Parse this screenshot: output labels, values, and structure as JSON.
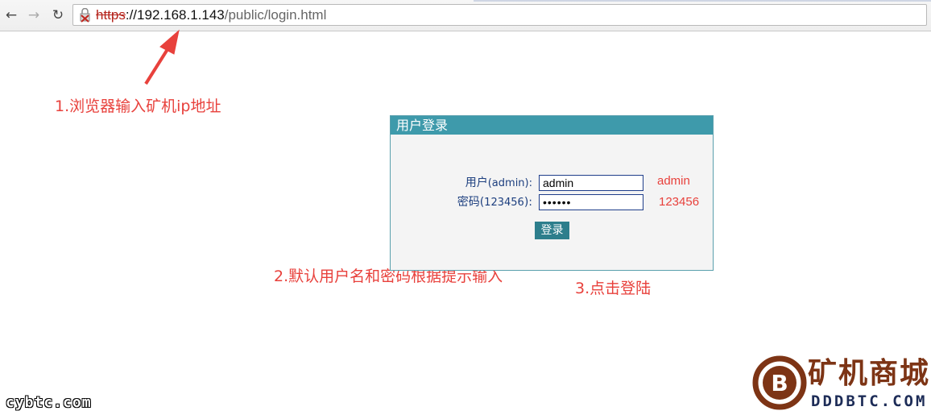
{
  "browser": {
    "url_scheme": "https",
    "url_host": "://192.168.1.143",
    "url_path": "/public/login.html",
    "icons": [
      "back-arrow-icon",
      "forward-arrow-icon",
      "reload-icon",
      "broken-lock-icon"
    ]
  },
  "annotations": {
    "step1": "1.浏览器输入矿机ip地址",
    "step2": "2.默认用户名和密码根据提示输入",
    "step3": "3.点击登陆",
    "hint_user": "admin",
    "hint_pass": "123456"
  },
  "login": {
    "title": "用户登录",
    "user_label_main": "用户",
    "user_label_paren": "(admin):",
    "pass_label_main": "密码",
    "pass_label_paren_open": "(",
    "pass_label_paren_value": "123456",
    "pass_label_paren_close": "):",
    "username_value": "admin",
    "password_value": "••••••",
    "submit_label": "登录"
  },
  "watermarks": {
    "left": "cybtc.com",
    "logo_title": "矿机商城",
    "logo_sub": "DDDBTC.COM"
  },
  "colors": {
    "annotation": "#e8413c",
    "panel_header": "#3e9aab",
    "button": "#2d7e8c",
    "label": "#1d3f7f",
    "logo": "#7d3415"
  }
}
